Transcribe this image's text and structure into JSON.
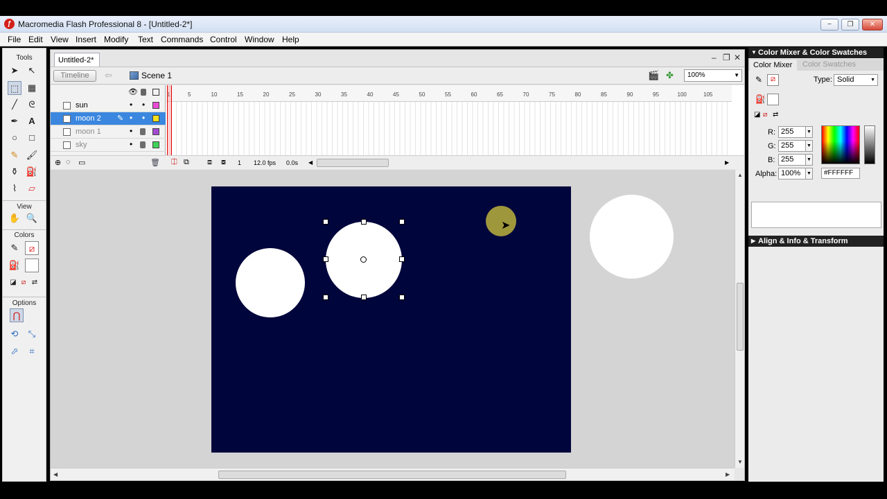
{
  "window": {
    "title": "Macromedia Flash Professional 8 - [Untitled-2*]",
    "icon": "flash-icon",
    "minimize": "−",
    "restore": "❐",
    "close": "✕"
  },
  "menu": [
    "File",
    "Edit",
    "View",
    "Insert",
    "Modify",
    "Text",
    "Commands",
    "Control",
    "Window",
    "Help"
  ],
  "tools": {
    "title": "Tools",
    "view_label": "View",
    "colors_label": "Colors",
    "options_label": "Options"
  },
  "document": {
    "tab": "Untitled-2*",
    "timeline_button": "Timeline",
    "scene": "Scene 1",
    "zoom": "100%"
  },
  "timeline": {
    "layers": [
      {
        "name": "sun",
        "color": "#e94bd5",
        "locked": false,
        "selected": false
      },
      {
        "name": "moon 2",
        "color": "#f5e21a",
        "locked": false,
        "selected": true
      },
      {
        "name": "moon 1",
        "color": "#a24ad0",
        "locked": true,
        "selected": false
      },
      {
        "name": "sky",
        "color": "#3fd257",
        "locked": true,
        "selected": false
      }
    ],
    "ticks": [
      "1",
      "5",
      "10",
      "15",
      "20",
      "25",
      "30",
      "35",
      "40",
      "45",
      "50",
      "55",
      "60",
      "65",
      "70",
      "75",
      "80",
      "85",
      "90",
      "95",
      "100",
      "105"
    ],
    "current_frame": "1",
    "fps": "12.0 fps",
    "time": "0.0s"
  },
  "stage": {
    "background": "#00053c",
    "moon_color": "#ffffff"
  },
  "color_mixer": {
    "panel_title": "Color Mixer & Color Swatches",
    "tab_mixer": "Color Mixer",
    "tab_swatches": "Color Swatches",
    "type_label": "Type:",
    "type_value": "Solid",
    "r_label": "R:",
    "r_value": "255",
    "g_label": "G:",
    "g_value": "255",
    "b_label": "B:",
    "b_value": "255",
    "alpha_label": "Alpha:",
    "alpha_value": "100%",
    "hex": "#FFFFFF"
  },
  "align_panel": {
    "title": "Align & Info & Transform"
  }
}
